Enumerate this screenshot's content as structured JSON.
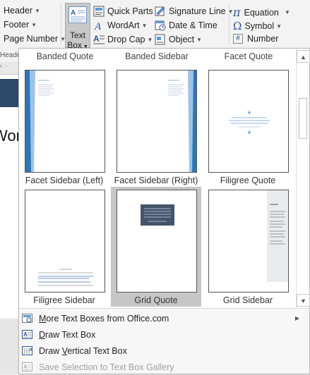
{
  "ribbon": {
    "header_footer": [
      {
        "label": "Header"
      },
      {
        "label": "Footer"
      },
      {
        "label": "Page Number"
      }
    ],
    "text_box": {
      "line1": "Text",
      "line2": "Box"
    },
    "text_group": [
      {
        "label": "Quick Parts",
        "icon": "quick-parts-icon"
      },
      {
        "label": "WordArt",
        "icon": "wordart-icon"
      },
      {
        "label": "Drop Cap",
        "icon": "drop-cap-icon"
      }
    ],
    "insert_group": [
      {
        "label": "Signature Line",
        "icon": "signature-line-icon"
      },
      {
        "label": "Date & Time",
        "icon": "date-time-icon"
      },
      {
        "label": "Object",
        "icon": "object-icon"
      }
    ],
    "symbols_group": [
      {
        "label": "Equation",
        "icon": "pi-icon",
        "glyph": "π"
      },
      {
        "label": "Symbol",
        "icon": "omega-icon",
        "glyph": "Ω"
      },
      {
        "label": "Number",
        "icon": "number-icon",
        "glyph": "#"
      }
    ]
  },
  "document": {
    "group_label": "Heade",
    "word_fragment": "Word"
  },
  "gallery": {
    "top_row": [
      "Banded Quote",
      "Banded Sidebar",
      "Facet Quote"
    ],
    "tiles": [
      {
        "label": "Facet Sidebar (Left)",
        "style": "facet-left"
      },
      {
        "label": "Facet Sidebar (Right)",
        "style": "facet-right"
      },
      {
        "label": "Filigree Quote",
        "style": "filigree-quote"
      },
      {
        "label": "Filigree Sidebar",
        "style": "filigree-sidebar"
      },
      {
        "label": "Grid Quote",
        "style": "grid-quote",
        "selected": true
      },
      {
        "label": "Grid Sidebar",
        "style": "grid-sidebar"
      }
    ]
  },
  "menu": [
    {
      "prefix": "M",
      "rest": "ore Text Boxes from Office.com",
      "icon": "office-web-icon",
      "submenu": true,
      "disabled": false
    },
    {
      "prefix": "D",
      "rest": "raw Text Box",
      "icon": "draw-textbox-icon",
      "submenu": false,
      "disabled": false
    },
    {
      "prefix": "",
      "rest": "Draw ",
      "prefix2": "V",
      "rest2": "ertical Text Box",
      "icon": "vertical-textbox-icon",
      "submenu": false,
      "disabled": false
    },
    {
      "prefix": "",
      "rest": "Save Selection to Text Box Gallery",
      "icon": "save-selection-icon",
      "submenu": false,
      "disabled": true
    }
  ],
  "colors": {
    "accent_blue": "#5b9bd5",
    "grid_dark": "#44546a",
    "selection_grey": "#c6c6c6"
  }
}
